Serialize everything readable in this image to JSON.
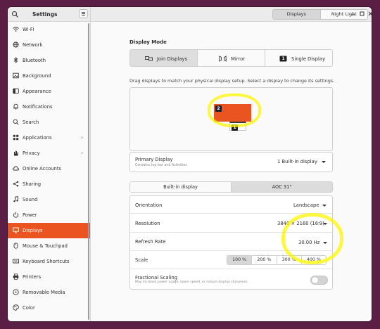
{
  "app": {
    "title": "Settings"
  },
  "header": {
    "tabs": [
      {
        "label": "Displays",
        "active": true
      },
      {
        "label": "Night Light",
        "active": false
      }
    ]
  },
  "sidebar": {
    "items": [
      {
        "label": "Wi-Fi",
        "icon": "wifi-icon"
      },
      {
        "label": "Network",
        "icon": "network-icon"
      },
      {
        "label": "Bluetooth",
        "icon": "bluetooth-icon"
      },
      {
        "label": "Background",
        "icon": "background-icon"
      },
      {
        "label": "Appearance",
        "icon": "appearance-icon"
      },
      {
        "label": "Notifications",
        "icon": "bell-icon"
      },
      {
        "label": "Search",
        "icon": "search-icon"
      },
      {
        "label": "Applications",
        "icon": "apps-icon",
        "chevron": true
      },
      {
        "label": "Privacy",
        "icon": "hand-icon",
        "chevron": true
      },
      {
        "label": "Online Accounts",
        "icon": "cloud-icon"
      },
      {
        "label": "Sharing",
        "icon": "share-icon"
      },
      {
        "label": "Sound",
        "icon": "music-note-icon"
      },
      {
        "label": "Power",
        "icon": "power-icon"
      },
      {
        "label": "Displays",
        "icon": "display-icon",
        "active": true
      },
      {
        "label": "Mouse & Touchpad",
        "icon": "mouse-icon"
      },
      {
        "label": "Keyboard Shortcuts",
        "icon": "keyboard-icon"
      },
      {
        "label": "Printers",
        "icon": "printer-icon"
      },
      {
        "label": "Removable Media",
        "icon": "media-icon"
      },
      {
        "label": "Color",
        "icon": "palette-icon"
      }
    ]
  },
  "main": {
    "display_mode": {
      "title": "Display Mode",
      "options": [
        {
          "label": "Join Displays",
          "active": true
        },
        {
          "label": "Mirror",
          "active": false
        },
        {
          "label": "Single Display",
          "active": false,
          "badge": "1"
        }
      ]
    },
    "arrange_hint": "Drag displays to match your physical display setup. Select a display to change its settings.",
    "arrangement": {
      "display_a": "2",
      "display_b": "1"
    },
    "primary_display": {
      "label": "Primary Display",
      "sublabel": "Contains top bar and Activities",
      "value": "1   Built-in display"
    },
    "output_tabs": [
      {
        "label": "Built-in display",
        "active": true
      },
      {
        "label": "AOC 31\"",
        "active": false
      }
    ],
    "settings": {
      "orientation": {
        "label": "Orientation",
        "value": "Landscape"
      },
      "resolution": {
        "label": "Resolution",
        "value": "3840 × 2160 (16∶9)"
      },
      "refresh_rate": {
        "label": "Refresh Rate",
        "value": "30.00 Hz"
      },
      "scale": {
        "label": "Scale",
        "options": [
          "100 %",
          "200 %",
          "300 %",
          "400 %"
        ],
        "selected": "100 %"
      },
      "fractional_scaling": {
        "label": "Fractional Scaling",
        "sublabel": "May increase power usage, lower speed, or reduce display sharpness.",
        "enabled": false
      }
    }
  },
  "colors": {
    "accent": "#e95420",
    "highlight": "#fff500",
    "desktop": "#5b1f46"
  }
}
